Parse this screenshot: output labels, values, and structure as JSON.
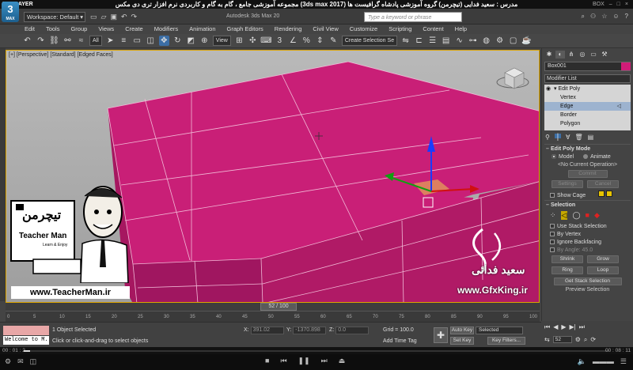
{
  "kmplayer": {
    "title": "KMPLAYER",
    "box": "BOX",
    "overlay_title": "مجموعه آموزشی جامع ، گام به گام و کاربردی نرم افزار تری دی مکس (3ds max 2017)   مدرس : سعید فدایی (تیچرمن) گروه آموزشی پادشاه گرافیست ها",
    "time_elapsed": "00 : 01 : 2",
    "time_total": "00 : 08 : 11",
    "ctrl_min": "–",
    "ctrl_max": "□",
    "ctrl_close": "×"
  },
  "max": {
    "app_letter": "3",
    "app_label": "MAX",
    "workspace": "Workspace: Default",
    "file_title": "Autodesk 3ds Max 20",
    "search_placeholder": "Type a keyword or phrase"
  },
  "menu": [
    "Edit",
    "Tools",
    "Group",
    "Views",
    "Create",
    "Modifiers",
    "Animation",
    "Graph Editors",
    "Rendering",
    "Civil View",
    "Customize",
    "Scripting",
    "Content",
    "Help"
  ],
  "toolbar": {
    "filter": "All",
    "ref_coord": "View",
    "selection_set": "Create Selection Se"
  },
  "viewport": {
    "label": "[+] [Perspective] [Standard] [Edged Faces]"
  },
  "watermark": {
    "brand_fa": "تیچرمن",
    "brand_en": "Teacher Man",
    "tagline": "Learn & Enjoy",
    "url": "www.TeacherMan.ir",
    "name_fa": "سعید فدائی",
    "url2": "www.GfxKing.ir"
  },
  "command_panel": {
    "object_name": "Box001",
    "modifier_list": "Modifier List",
    "stack": [
      {
        "label": "Edit Poly",
        "level": "top"
      },
      {
        "label": "Vertex",
        "level": "sub"
      },
      {
        "label": "Edge",
        "level": "sub",
        "selected": true
      },
      {
        "label": "Border",
        "level": "sub"
      },
      {
        "label": "Polygon",
        "level": "sub"
      }
    ],
    "edit_poly_mode": {
      "title": "Edit Poly Mode",
      "model": "Model",
      "animate": "Animate",
      "no_op": "<No Current Operation>",
      "commit": "Commit",
      "settings": "Settings",
      "cancel": "Cancel",
      "show_cage": "Show Cage"
    },
    "selection": {
      "title": "Selection",
      "use_stack": "Use Stack Selection",
      "by_vertex": "By Vertex",
      "ignore_backfacing": "Ignore Backfacing",
      "by_angle": "By Angle:",
      "by_angle_val": "45.0",
      "shrink": "Shrink",
      "grow": "Grow",
      "ring": "Ring",
      "loop": "Loop",
      "get_stack": "Get Stack Selection",
      "preview": "Preview Selection"
    }
  },
  "timeline": {
    "slider": "52 / 100",
    "ticks": [
      "0",
      "5",
      "10",
      "15",
      "20",
      "25",
      "30",
      "35",
      "40",
      "45",
      "50",
      "55",
      "60",
      "65",
      "70",
      "75",
      "80",
      "85",
      "90",
      "95",
      "100"
    ]
  },
  "status": {
    "listener": "Welcome to M.",
    "selected": "1 Object Selected",
    "prompt": "Click or click-and-drag to select objects",
    "x_label": "X:",
    "x_val": "391.02",
    "y_label": "Y:",
    "y_val": "-1370.898",
    "z_label": "Z:",
    "z_val": "0.0",
    "grid": "Grid = 100.0",
    "add_time_tag": "Add Time Tag",
    "auto_key": "Auto Key",
    "set_key": "Set Key",
    "selected_dd": "Selected",
    "key_filters": "Key Filters...",
    "frame": "52"
  },
  "colors": {
    "box_face_top": "#c41d72",
    "box_face_front": "#b0185f",
    "box_face_side": "#8d1248",
    "accent": "#dca400"
  }
}
